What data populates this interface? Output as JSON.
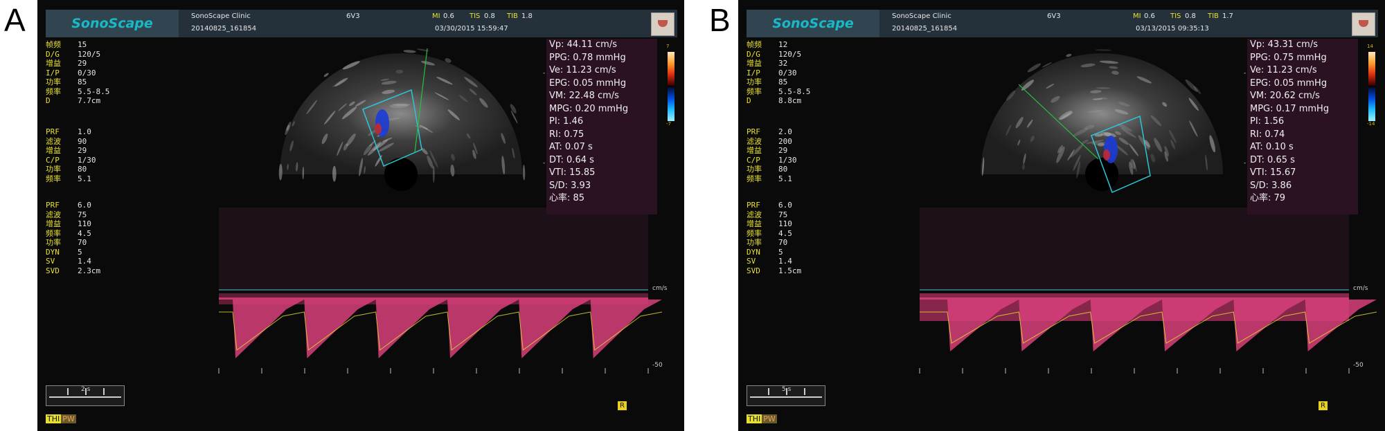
{
  "panels": [
    {
      "letter": "A",
      "brand": "SonoScape",
      "clinic": "SonoScape Clinic",
      "probe": "6V3",
      "mi_label": "MI",
      "mi": "0.6",
      "tis_label": "TIS",
      "tis": "0.8",
      "tib_label": "TIB",
      "tib": "1.8",
      "patient_id": "20140825_161854",
      "datetime": "03/30/2015 15:59:47",
      "bmode_params": [
        {
          "k": "帧频",
          "v": "15"
        },
        {
          "k": "D/G",
          "v": "120/5"
        },
        {
          "k": "增益",
          "v": "29"
        },
        {
          "k": "I/P",
          "v": "0/30"
        },
        {
          "k": "功率",
          "v": "85"
        },
        {
          "k": "频率",
          "v": "5.5-8.5"
        },
        {
          "k": "D",
          "v": "7.7cm"
        }
      ],
      "color_params": [
        {
          "k": "PRF",
          "v": "1.0"
        },
        {
          "k": "滤波",
          "v": "90"
        },
        {
          "k": "增益",
          "v": "29"
        },
        {
          "k": "C/P",
          "v": "1/30"
        },
        {
          "k": "功率",
          "v": "80"
        },
        {
          "k": "频率",
          "v": "5.1"
        }
      ],
      "pw_params": [
        {
          "k": "PRF",
          "v": "6.0"
        },
        {
          "k": "滤波",
          "v": "75"
        },
        {
          "k": "增益",
          "v": "110"
        },
        {
          "k": "频率",
          "v": "4.5"
        },
        {
          "k": "功率",
          "v": "70"
        },
        {
          "k": "DYN",
          "v": "5"
        },
        {
          "k": "SV",
          "v": "1.4"
        },
        {
          "k": "SVD",
          "v": "2.3cm"
        }
      ],
      "measurements": [
        "Vp: 44.11 cm/s",
        "PPG: 0.78 mmHg",
        "Ve: 11.23 cm/s",
        "EPG: 0.05 mmHg",
        "VM: 22.48 cm/s",
        "MPG: 0.20 mmHg",
        "PI: 1.46",
        "RI: 0.75",
        "AT: 0.07 s",
        "DT: 0.64 s",
        "VTI: 15.85",
        "S/D: 3.93",
        "心率:  85"
      ],
      "colorbar_top": "7",
      "colorbar_bottom": "-7",
      "colorbar_unit": "cm/s",
      "depth_marks": [
        "5",
        "0"
      ],
      "doppler_unit": "cm/s",
      "doppler_min": "-50",
      "scale_label": "2 s",
      "mode_thi": "THI",
      "mode_pw": "PW",
      "badge": "R"
    },
    {
      "letter": "B",
      "brand": "SonoScape",
      "clinic": "SonoScape Clinic",
      "probe": "6V3",
      "mi_label": "MI",
      "mi": "0.6",
      "tis_label": "TIS",
      "tis": "0.8",
      "tib_label": "TIB",
      "tib": "1.7",
      "patient_id": "20140825_161854",
      "datetime": "03/13/2015 09:35:13",
      "bmode_params": [
        {
          "k": "帧频",
          "v": "12"
        },
        {
          "k": "D/G",
          "v": "120/5"
        },
        {
          "k": "增益",
          "v": "32"
        },
        {
          "k": "I/P",
          "v": "0/30"
        },
        {
          "k": "功率",
          "v": "85"
        },
        {
          "k": "频率",
          "v": "5.5-8.5"
        },
        {
          "k": "D",
          "v": "8.8cm"
        }
      ],
      "color_params": [
        {
          "k": "PRF",
          "v": "2.0"
        },
        {
          "k": "滤波",
          "v": "200"
        },
        {
          "k": "增益",
          "v": "29"
        },
        {
          "k": "C/P",
          "v": "1/30"
        },
        {
          "k": "功率",
          "v": "80"
        },
        {
          "k": "频率",
          "v": "5.1"
        }
      ],
      "pw_params": [
        {
          "k": "PRF",
          "v": "6.0"
        },
        {
          "k": "滤波",
          "v": "75"
        },
        {
          "k": "增益",
          "v": "110"
        },
        {
          "k": "频率",
          "v": "4.5"
        },
        {
          "k": "功率",
          "v": "70"
        },
        {
          "k": "DYN",
          "v": "5"
        },
        {
          "k": "SV",
          "v": "1.4"
        },
        {
          "k": "SVD",
          "v": "1.5cm"
        }
      ],
      "measurements": [
        "Vp: 43.31 cm/s",
        "PPG: 0.75 mmHg",
        "Ve: 11.23 cm/s",
        "EPG: 0.05 mmHg",
        "VM: 20.62 cm/s",
        "MPG: 0.17 mmHg",
        "PI: 1.56",
        "RI: 0.74",
        "AT: 0.10 s",
        "DT: 0.65 s",
        "VTI: 15.67",
        "S/D: 3.86",
        "心率:  79"
      ],
      "colorbar_top": "14",
      "colorbar_bottom": "-14",
      "colorbar_unit": "cm/s",
      "depth_marks": [
        "5",
        "0"
      ],
      "doppler_unit": "cm/s",
      "doppler_min": "-50",
      "scale_label": "5 s",
      "mode_thi": "THI",
      "mode_pw": "PW",
      "badge": "R"
    }
  ],
  "colors": {
    "label_yellow": "#e8e030",
    "brand_cyan": "#19b9c8",
    "spectrum_pink": "#d8407a",
    "trace_yellow": "#e8e030"
  }
}
